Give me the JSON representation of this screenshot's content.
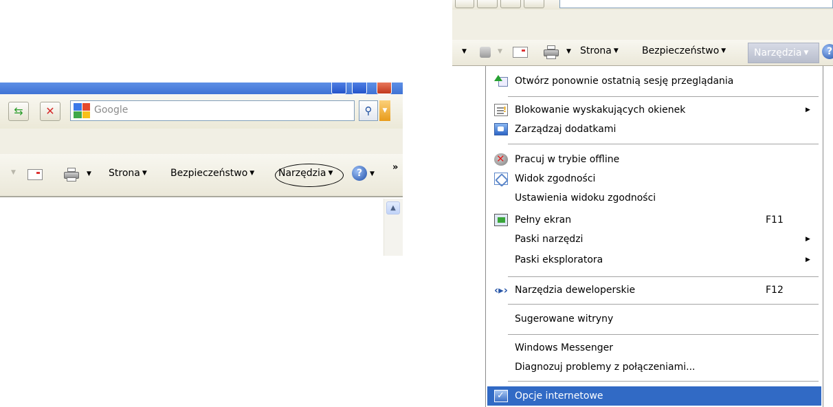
{
  "left_panel": {
    "search": {
      "placeholder": "Google"
    },
    "toolbar": {
      "page_label": "Strona",
      "security_label": "Bezpieczeństwo",
      "tools_label": "Narzędzia",
      "more_label": "»"
    }
  },
  "right_panel": {
    "toolbar": {
      "page_label": "Strona",
      "security_label": "Bezpieczeństwo",
      "tools_label": "Narzędzia"
    },
    "tools_menu": {
      "items": [
        {
          "label": "Otwórz ponownie ostatnią sesję przeglądania",
          "icon": "reopen-session-icon"
        },
        {
          "label": "Blokowanie wyskakujących okienek",
          "icon": "popup-blocker-icon",
          "submenu": true
        },
        {
          "label": "Zarządzaj dodatkami",
          "icon": "manage-addons-icon"
        },
        {
          "label": "Pracuj w trybie offline",
          "icon": "work-offline-icon"
        },
        {
          "label": "Widok zgodności",
          "icon": "compatibility-view-icon"
        },
        {
          "label": "Ustawienia widoku zgodności"
        },
        {
          "label": "Pełny ekran",
          "icon": "full-screen-icon",
          "shortcut": "F11"
        },
        {
          "label": "Paski narzędzi",
          "submenu": true
        },
        {
          "label": "Paski eksploratora",
          "submenu": true
        },
        {
          "label": "Narzędzia deweloperskie",
          "icon": "developer-tools-icon",
          "shortcut": "F12"
        },
        {
          "label": "Sugerowane witryny"
        },
        {
          "label": "Windows Messenger"
        },
        {
          "label": "Diagnozuj problemy z połączeniami..."
        },
        {
          "label": "Opcje internetowe",
          "icon": "internet-options-icon",
          "selected": true
        }
      ]
    }
  }
}
